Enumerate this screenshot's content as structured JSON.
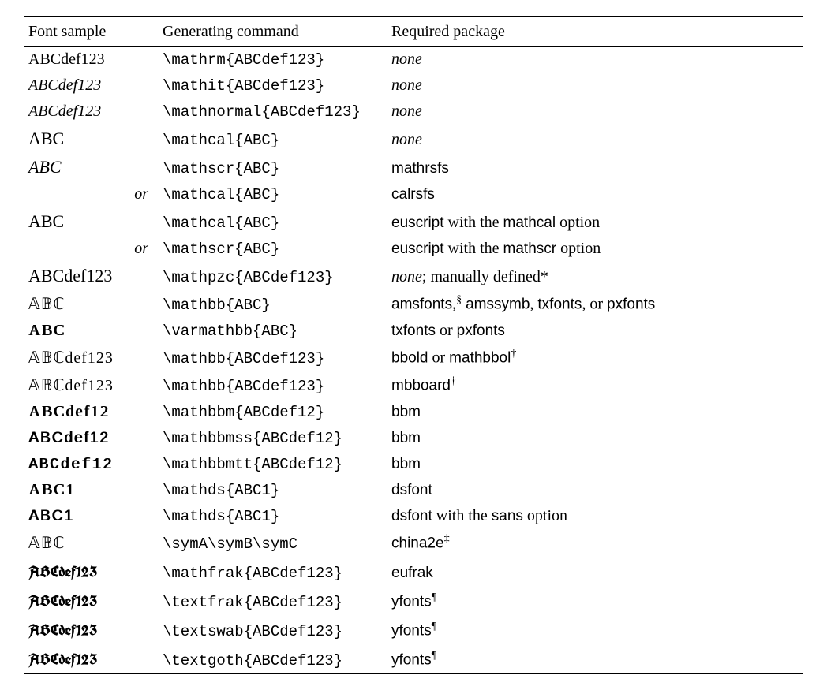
{
  "chart_data": {
    "type": "table",
    "title": "",
    "columns": [
      "Font sample",
      "Generating command",
      "Required package"
    ],
    "rows": [
      {
        "sample": "ABCdef123",
        "sample_style": "rm",
        "command": "\\mathrm{ABCdef123}",
        "package_parts": [
          {
            "text": "none",
            "cls": "it"
          }
        ]
      },
      {
        "sample": "ABCdef123",
        "sample_style": "it",
        "command": "\\mathit{ABCdef123}",
        "package_parts": [
          {
            "text": "none",
            "cls": "it"
          }
        ]
      },
      {
        "sample": "ABCdef123",
        "sample_style": "it",
        "command": "\\mathnormal{ABCdef123}",
        "package_parts": [
          {
            "text": "none",
            "cls": "it"
          }
        ]
      },
      {
        "sample": "ABC",
        "sample_style": "cal",
        "command": "\\mathcal{ABC}",
        "package_parts": [
          {
            "text": "none",
            "cls": "it"
          }
        ]
      },
      {
        "sample": "ABC",
        "sample_style": "scr",
        "command": "\\mathscr{ABC}",
        "package_parts": [
          {
            "text": "mathrsfs",
            "cls": "sf"
          }
        ]
      },
      {
        "sample": "or",
        "sample_style": "or",
        "command": "\\mathcal{ABC}",
        "package_parts": [
          {
            "text": "calrsfs",
            "cls": "sf"
          }
        ]
      },
      {
        "sample": "ABC",
        "sample_style": "cal",
        "command": "\\mathcal{ABC}",
        "package_parts": [
          {
            "text": "euscript",
            "cls": "sf"
          },
          {
            "text": " with the ",
            "cls": "rm"
          },
          {
            "text": "mathcal",
            "cls": "sf"
          },
          {
            "text": " option",
            "cls": "rm"
          }
        ]
      },
      {
        "sample": "or",
        "sample_style": "or",
        "command": "\\mathscr{ABC}",
        "package_parts": [
          {
            "text": "euscript",
            "cls": "sf"
          },
          {
            "text": " with the ",
            "cls": "rm"
          },
          {
            "text": "mathscr",
            "cls": "sf"
          },
          {
            "text": " option",
            "cls": "rm"
          }
        ]
      },
      {
        "sample": "ABCdef123",
        "sample_style": "cal",
        "command": "\\mathpzc{ABCdef123}",
        "package_parts": [
          {
            "text": "none",
            "cls": "it"
          },
          {
            "text": "; manually defined*",
            "cls": "rm"
          }
        ]
      },
      {
        "sample": "𝔸𝔹ℂ",
        "sample_style": "bb",
        "command": "\\mathbb{ABC}",
        "package_parts": [
          {
            "text": "amsfonts",
            "cls": "sf"
          },
          {
            "text": ",",
            "cls": "rm"
          },
          {
            "text": "§",
            "cls": "sup"
          },
          {
            "text": " ",
            "cls": "rm"
          },
          {
            "text": "amssymb",
            "cls": "sf"
          },
          {
            "text": ", ",
            "cls": "rm"
          },
          {
            "text": "txfonts",
            "cls": "sf"
          },
          {
            "text": ", or ",
            "cls": "rm"
          },
          {
            "text": "pxfonts",
            "cls": "sf"
          }
        ]
      },
      {
        "sample": "ABC",
        "sample_style": "dbl",
        "command": "\\varmathbb{ABC}",
        "package_parts": [
          {
            "text": "txfonts",
            "cls": "sf"
          },
          {
            "text": " or ",
            "cls": "rm"
          },
          {
            "text": "pxfonts",
            "cls": "sf"
          }
        ]
      },
      {
        "sample": "𝔸𝔹ℂdef123",
        "sample_style": "bb",
        "command": "\\mathbb{ABCdef123}",
        "package_parts": [
          {
            "text": "bbold",
            "cls": "sf"
          },
          {
            "text": " or ",
            "cls": "rm"
          },
          {
            "text": "mathbbol",
            "cls": "sf"
          },
          {
            "text": "†",
            "cls": "sup"
          }
        ]
      },
      {
        "sample": "𝔸𝔹ℂdef123",
        "sample_style": "bb",
        "command": "\\mathbb{ABCdef123}",
        "package_parts": [
          {
            "text": "mbboard",
            "cls": "sf"
          },
          {
            "text": "†",
            "cls": "sup"
          }
        ]
      },
      {
        "sample": "ABCdef12",
        "sample_style": "dbl",
        "command": "\\mathbbm{ABCdef12}",
        "package_parts": [
          {
            "text": "bbm",
            "cls": "sf"
          }
        ]
      },
      {
        "sample": "ABCdef12",
        "sample_style": "dbl sf",
        "command": "\\mathbbmss{ABCdef12}",
        "package_parts": [
          {
            "text": "bbm",
            "cls": "sf"
          }
        ]
      },
      {
        "sample": "ABCdef12",
        "sample_style": "dbl tt",
        "command": "\\mathbbmtt{ABCdef12}",
        "package_parts": [
          {
            "text": "bbm",
            "cls": "sf"
          }
        ]
      },
      {
        "sample": "ABC1",
        "sample_style": "dbl",
        "command": "\\mathds{ABC1}",
        "package_parts": [
          {
            "text": "dsfont",
            "cls": "sf"
          }
        ]
      },
      {
        "sample": "ABC1",
        "sample_style": "dbl sf",
        "command": "\\mathds{ABC1}",
        "package_parts": [
          {
            "text": "dsfont",
            "cls": "sf"
          },
          {
            "text": " with the ",
            "cls": "rm"
          },
          {
            "text": "sans",
            "cls": "sf"
          },
          {
            "text": " option",
            "cls": "rm"
          }
        ]
      },
      {
        "sample": "𝔸𝔹ℂ",
        "sample_style": "bb",
        "command": "\\symA\\symB\\symC",
        "package_parts": [
          {
            "text": "china2e",
            "cls": "sf"
          },
          {
            "text": "‡",
            "cls": "sup"
          }
        ]
      },
      {
        "sample": "ABCdef123",
        "sample_style": "frak",
        "command": "\\mathfrak{ABCdef123}",
        "package_parts": [
          {
            "text": "eufrak",
            "cls": "sf"
          }
        ]
      },
      {
        "sample": "ABCdef123",
        "sample_style": "frak",
        "command": "\\textfrak{ABCdef123}",
        "package_parts": [
          {
            "text": "yfonts",
            "cls": "sf"
          },
          {
            "text": "¶",
            "cls": "sup"
          }
        ]
      },
      {
        "sample": "ABCdef123",
        "sample_style": "frak",
        "command": "\\textswab{ABCdef123}",
        "package_parts": [
          {
            "text": "yfonts",
            "cls": "sf"
          },
          {
            "text": "¶",
            "cls": "sup"
          }
        ]
      },
      {
        "sample": "ABCdef123",
        "sample_style": "frak",
        "command": "\\textgoth{ABCdef123}",
        "package_parts": [
          {
            "text": "yfonts",
            "cls": "sf"
          },
          {
            "text": "¶",
            "cls": "sup"
          }
        ]
      }
    ]
  },
  "headers": {
    "sample": "Font sample",
    "command": "Generating command",
    "package": "Required package"
  }
}
